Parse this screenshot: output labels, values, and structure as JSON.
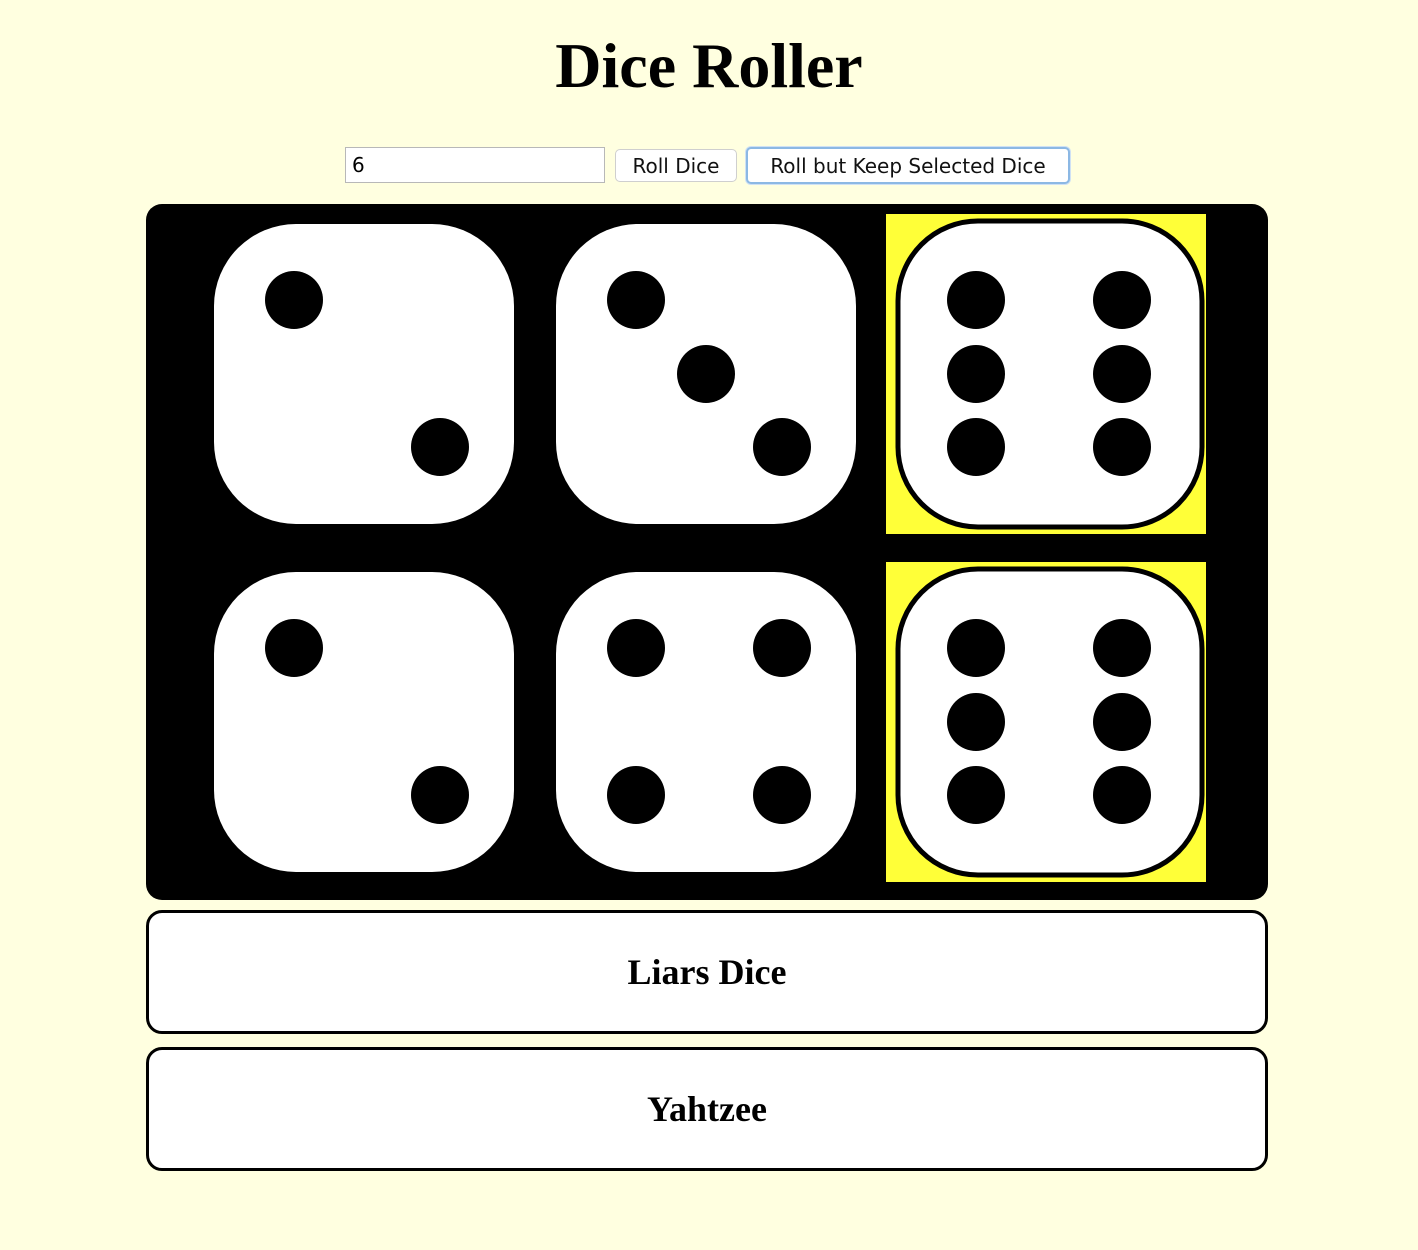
{
  "page": {
    "title": "Dice Roller",
    "background_color": "#ffffe0"
  },
  "controls": {
    "dice_count_value": "6",
    "roll_button_label": "Roll Dice",
    "roll_keep_button_label": "Roll but Keep Selected Dice"
  },
  "dice": [
    {
      "value": 2,
      "held": false
    },
    {
      "value": 3,
      "held": false
    },
    {
      "value": 6,
      "held": true
    },
    {
      "value": 2,
      "held": false
    },
    {
      "value": 4,
      "held": false
    },
    {
      "value": 6,
      "held": true
    }
  ],
  "colors": {
    "board": "#000000",
    "die_face": "#ffffff",
    "pip": "#000000",
    "held_highlight": "#ffff38",
    "focus_ring": "#8cb8e4"
  },
  "games": [
    {
      "label": "Liars Dice"
    },
    {
      "label": "Yahtzee"
    }
  ]
}
